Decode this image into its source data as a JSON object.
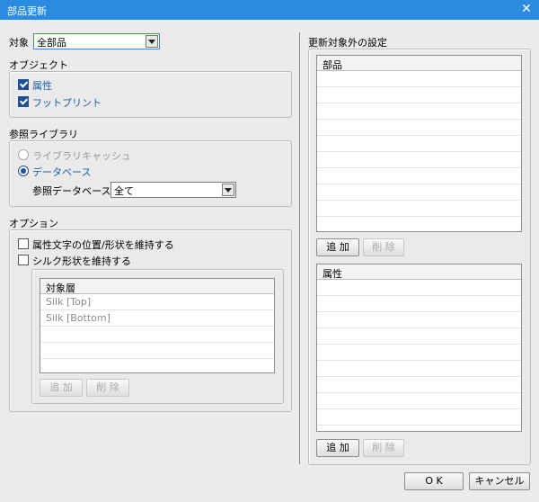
{
  "window": {
    "title": "部品更新",
    "close_symbol": "✕"
  },
  "target": {
    "label": "対象",
    "selected": "全部品"
  },
  "object_group": {
    "title": "オブジェクト",
    "items": [
      {
        "label": "属性",
        "checked": true
      },
      {
        "label": "フットプリント",
        "checked": true
      }
    ]
  },
  "library_group": {
    "title": "参照ライブラリ",
    "options": [
      {
        "label": "ライブラリキャッシュ",
        "selected": false
      },
      {
        "label": "データベース",
        "selected": true
      }
    ],
    "db_label": "参照データベース",
    "db_selected": "全て"
  },
  "option_group": {
    "title": "オプション",
    "checks": [
      {
        "label": "属性文字の位置/形状を維持する",
        "checked": false
      },
      {
        "label": "シルク形状を維持する",
        "checked": false
      }
    ]
  },
  "layer_table": {
    "header": "対象層",
    "rows": [
      "Silk [Top]",
      "Silk [Bottom]"
    ],
    "add_label": "追 加",
    "delete_label": "削 除"
  },
  "exclusion": {
    "title": "更新対象外の設定",
    "parts_header": "部品",
    "attr_header": "属性",
    "add_label": "追 加",
    "delete_label": "削 除"
  },
  "footer": {
    "ok": "O K",
    "cancel": "キャンセル"
  }
}
